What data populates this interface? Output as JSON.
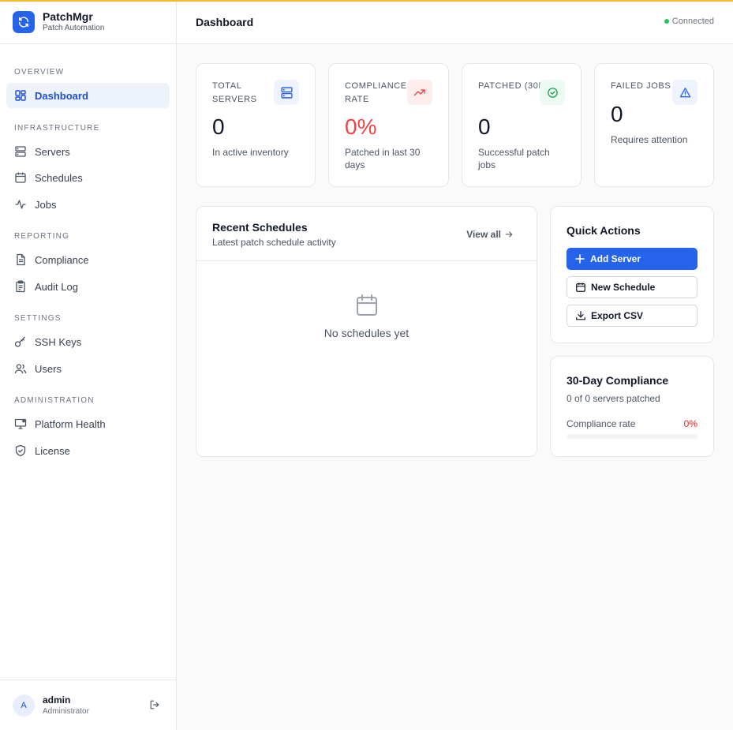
{
  "brand": {
    "title": "PatchMgr",
    "subtitle": "Patch Automation"
  },
  "header": {
    "title": "Dashboard",
    "status": "Connected"
  },
  "sidebar": {
    "sections": [
      {
        "label": "OVERVIEW",
        "items": [
          {
            "label": "Dashboard",
            "icon": "dashboard-icon",
            "active": true
          }
        ]
      },
      {
        "label": "INFRASTRUCTURE",
        "items": [
          {
            "label": "Servers",
            "icon": "server-icon"
          },
          {
            "label": "Schedules",
            "icon": "calendar-icon"
          },
          {
            "label": "Jobs",
            "icon": "activity-icon"
          }
        ]
      },
      {
        "label": "REPORTING",
        "items": [
          {
            "label": "Compliance",
            "icon": "document-icon"
          },
          {
            "label": "Audit Log",
            "icon": "clipboard-icon"
          }
        ]
      },
      {
        "label": "SETTINGS",
        "items": [
          {
            "label": "SSH Keys",
            "icon": "key-icon"
          },
          {
            "label": "Users",
            "icon": "users-icon"
          }
        ]
      },
      {
        "label": "ADMINISTRATION",
        "items": [
          {
            "label": "Platform Health",
            "icon": "monitor-icon"
          },
          {
            "label": "License",
            "icon": "shield-icon"
          }
        ]
      }
    ]
  },
  "user": {
    "initial": "A",
    "name": "admin",
    "role": "Administrator"
  },
  "stats": [
    {
      "label": "TOTAL SERVERS",
      "value": "0",
      "sub": "In active inventory",
      "icon": "server-icon",
      "color": "#2563eb",
      "bg": "#eef3fd"
    },
    {
      "label": "COMPLIANCE RATE",
      "value": "0%",
      "sub": "Patched in last 30 days",
      "icon": "trending-up-icon",
      "color": "#ef4444",
      "bg": "#fdeeee"
    },
    {
      "label": "PATCHED (30D)",
      "value": "0",
      "sub": "Successful patch jobs",
      "icon": "check-circle-icon",
      "color": "#16a34a",
      "bg": "#ecfaf1"
    },
    {
      "label": "FAILED JOBS",
      "value": "0",
      "sub": "Requires attention",
      "icon": "alert-triangle-icon",
      "color": "#2563eb",
      "bg": "#eef3fd"
    }
  ],
  "recent_schedules": {
    "title": "Recent Schedules",
    "subtitle": "Latest patch schedule activity",
    "view_all": "View all",
    "empty": "No schedules yet"
  },
  "quick_actions": {
    "title": "Quick Actions",
    "add_server": "Add Server",
    "new_schedule": "New Schedule",
    "export_csv": "Export CSV"
  },
  "compliance": {
    "title": "30-Day Compliance",
    "subtitle": "0 of 0 servers patched",
    "rate_label": "Compliance rate",
    "rate_value": "0%",
    "rate_fraction": 0
  },
  "colors": {
    "accent": "#2563eb",
    "danger": "#dc2626",
    "success": "#22c55e"
  }
}
